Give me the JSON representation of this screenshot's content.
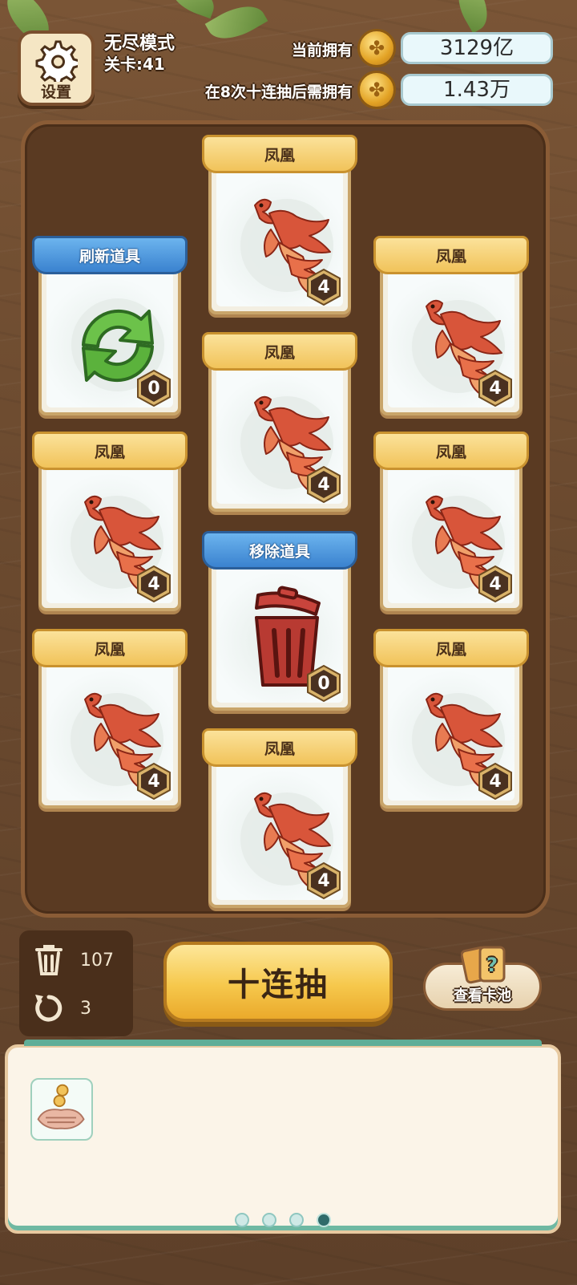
{
  "header": {
    "settings_label": "设置",
    "mode": "无尽模式",
    "level": "关卡:41",
    "owned_label": "当前拥有",
    "owned_value": "3129亿",
    "required_label": "在8次十连抽后需拥有",
    "required_value": "1.43万"
  },
  "cards": [
    {
      "id": "c1",
      "type": "gold",
      "title": "凤凰",
      "count": "4",
      "art": "phoenix"
    },
    {
      "id": "c2",
      "type": "blue",
      "title": "刷新道具",
      "count": "0",
      "art": "refresh"
    },
    {
      "id": "c3",
      "type": "gold",
      "title": "凤凰",
      "count": "4",
      "art": "phoenix"
    },
    {
      "id": "c4",
      "type": "gold",
      "title": "凤凰",
      "count": "4",
      "art": "phoenix"
    },
    {
      "id": "c5",
      "type": "gold",
      "title": "凤凰",
      "count": "4",
      "art": "phoenix"
    },
    {
      "id": "c6",
      "type": "gold",
      "title": "凤凰",
      "count": "4",
      "art": "phoenix"
    },
    {
      "id": "c7",
      "type": "blue",
      "title": "移除道具",
      "count": "0",
      "art": "trash"
    },
    {
      "id": "c8",
      "type": "gold",
      "title": "凤凰",
      "count": "4",
      "art": "phoenix"
    },
    {
      "id": "c9",
      "type": "gold",
      "title": "凤凰",
      "count": "4",
      "art": "phoenix"
    },
    {
      "id": "c10",
      "type": "gold",
      "title": "凤凰",
      "count": "4",
      "art": "phoenix"
    }
  ],
  "controls": {
    "remove_count": "107",
    "refresh_count": "3",
    "draw_label": "十连抽",
    "pool_label": "查看卡池"
  },
  "pager": {
    "pages": 4,
    "active_page": 4
  },
  "colors": {
    "gold_ribbon": "#f1c35a",
    "blue_ribbon": "#3a82cf",
    "board": "#5a3a22",
    "badge": "#4a3120"
  }
}
